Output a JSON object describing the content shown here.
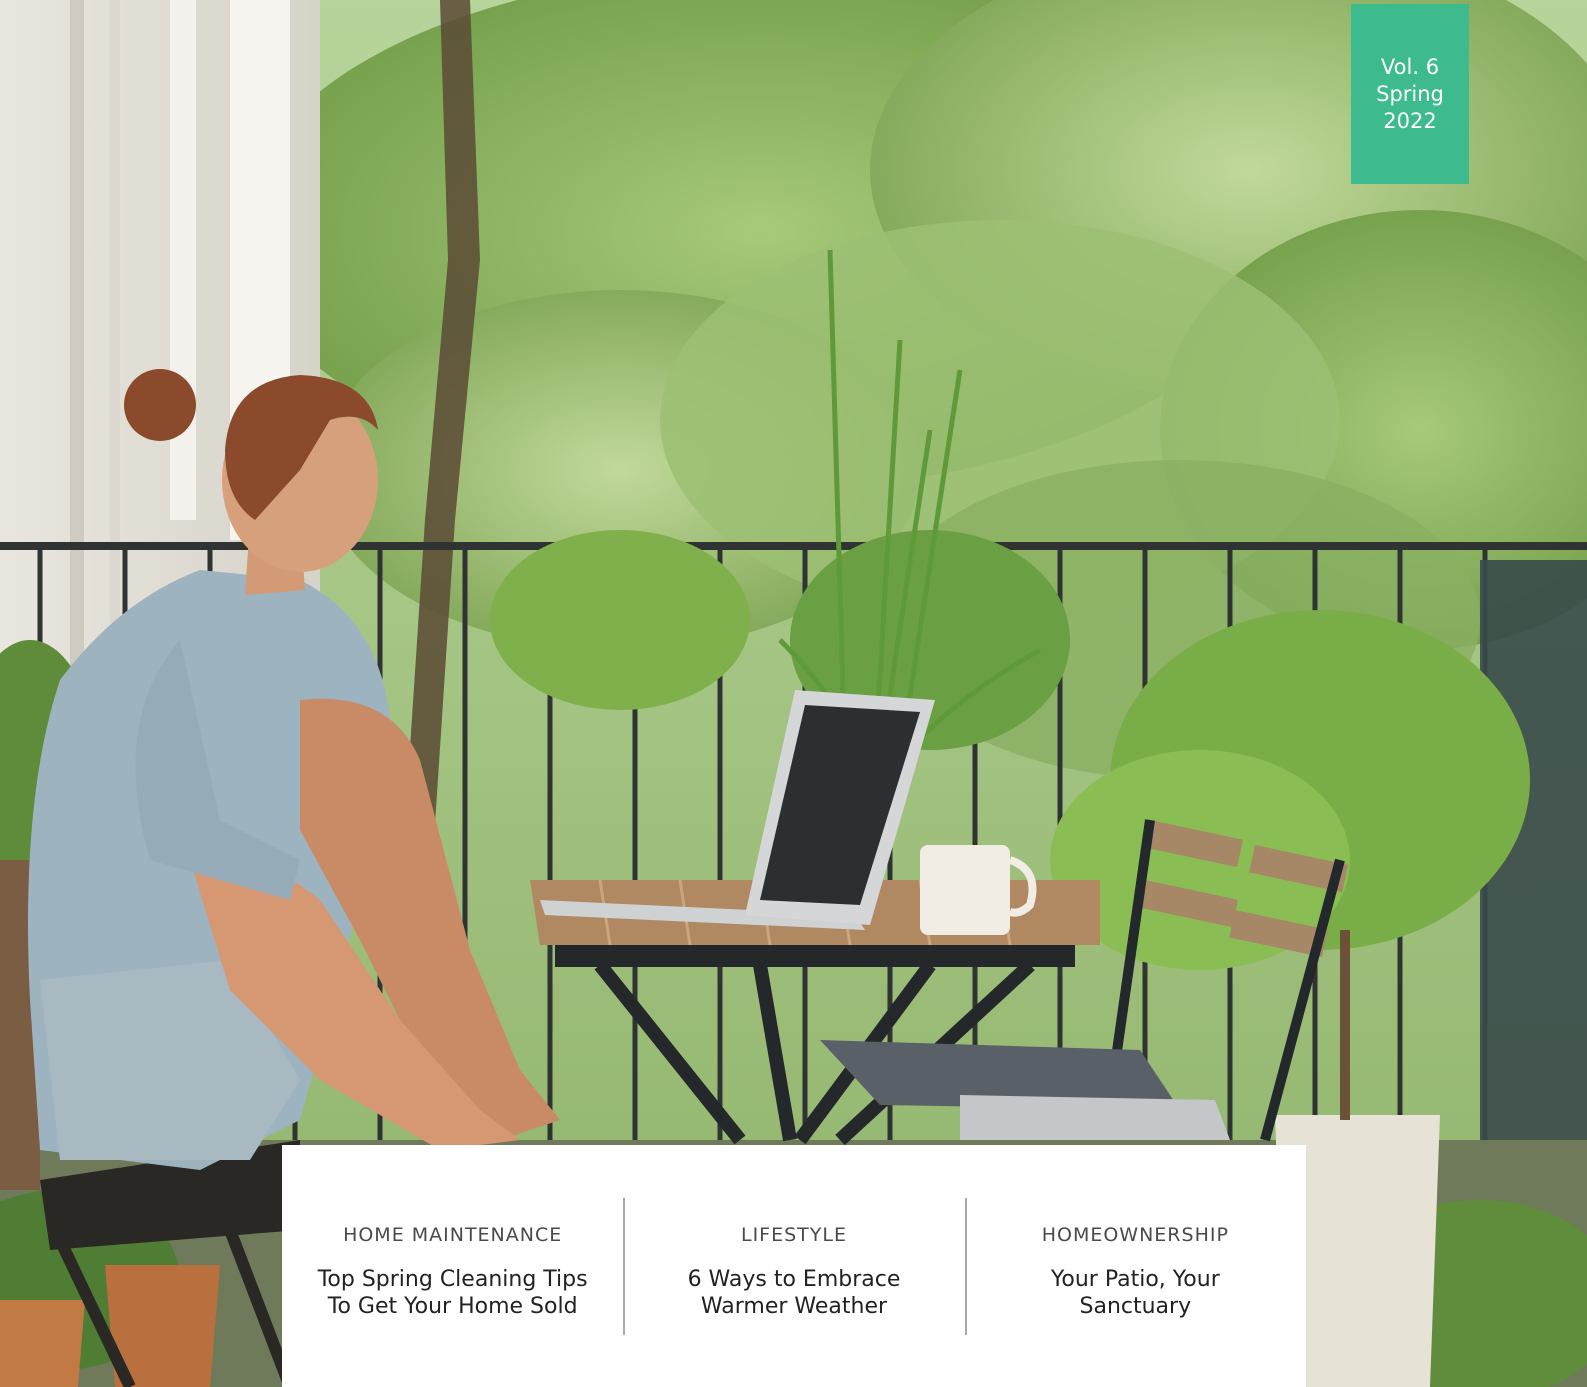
{
  "badge": {
    "volume": "Vol. 6",
    "season": "Spring",
    "year": "2022",
    "color": "#3dbb8e"
  },
  "hero": {
    "image": "balcony-woman-laptop-photo"
  },
  "articles": [
    {
      "category": "HOME MAINTENANCE",
      "title": "Top Spring Cleaning Tips To Get Your Home Sold"
    },
    {
      "category": "LIFESTYLE",
      "title": "6 Ways to Embrace Warmer Weather"
    },
    {
      "category": "HOMEOWNERSHIP",
      "title": "Your Patio, Your Sanctuary"
    }
  ]
}
